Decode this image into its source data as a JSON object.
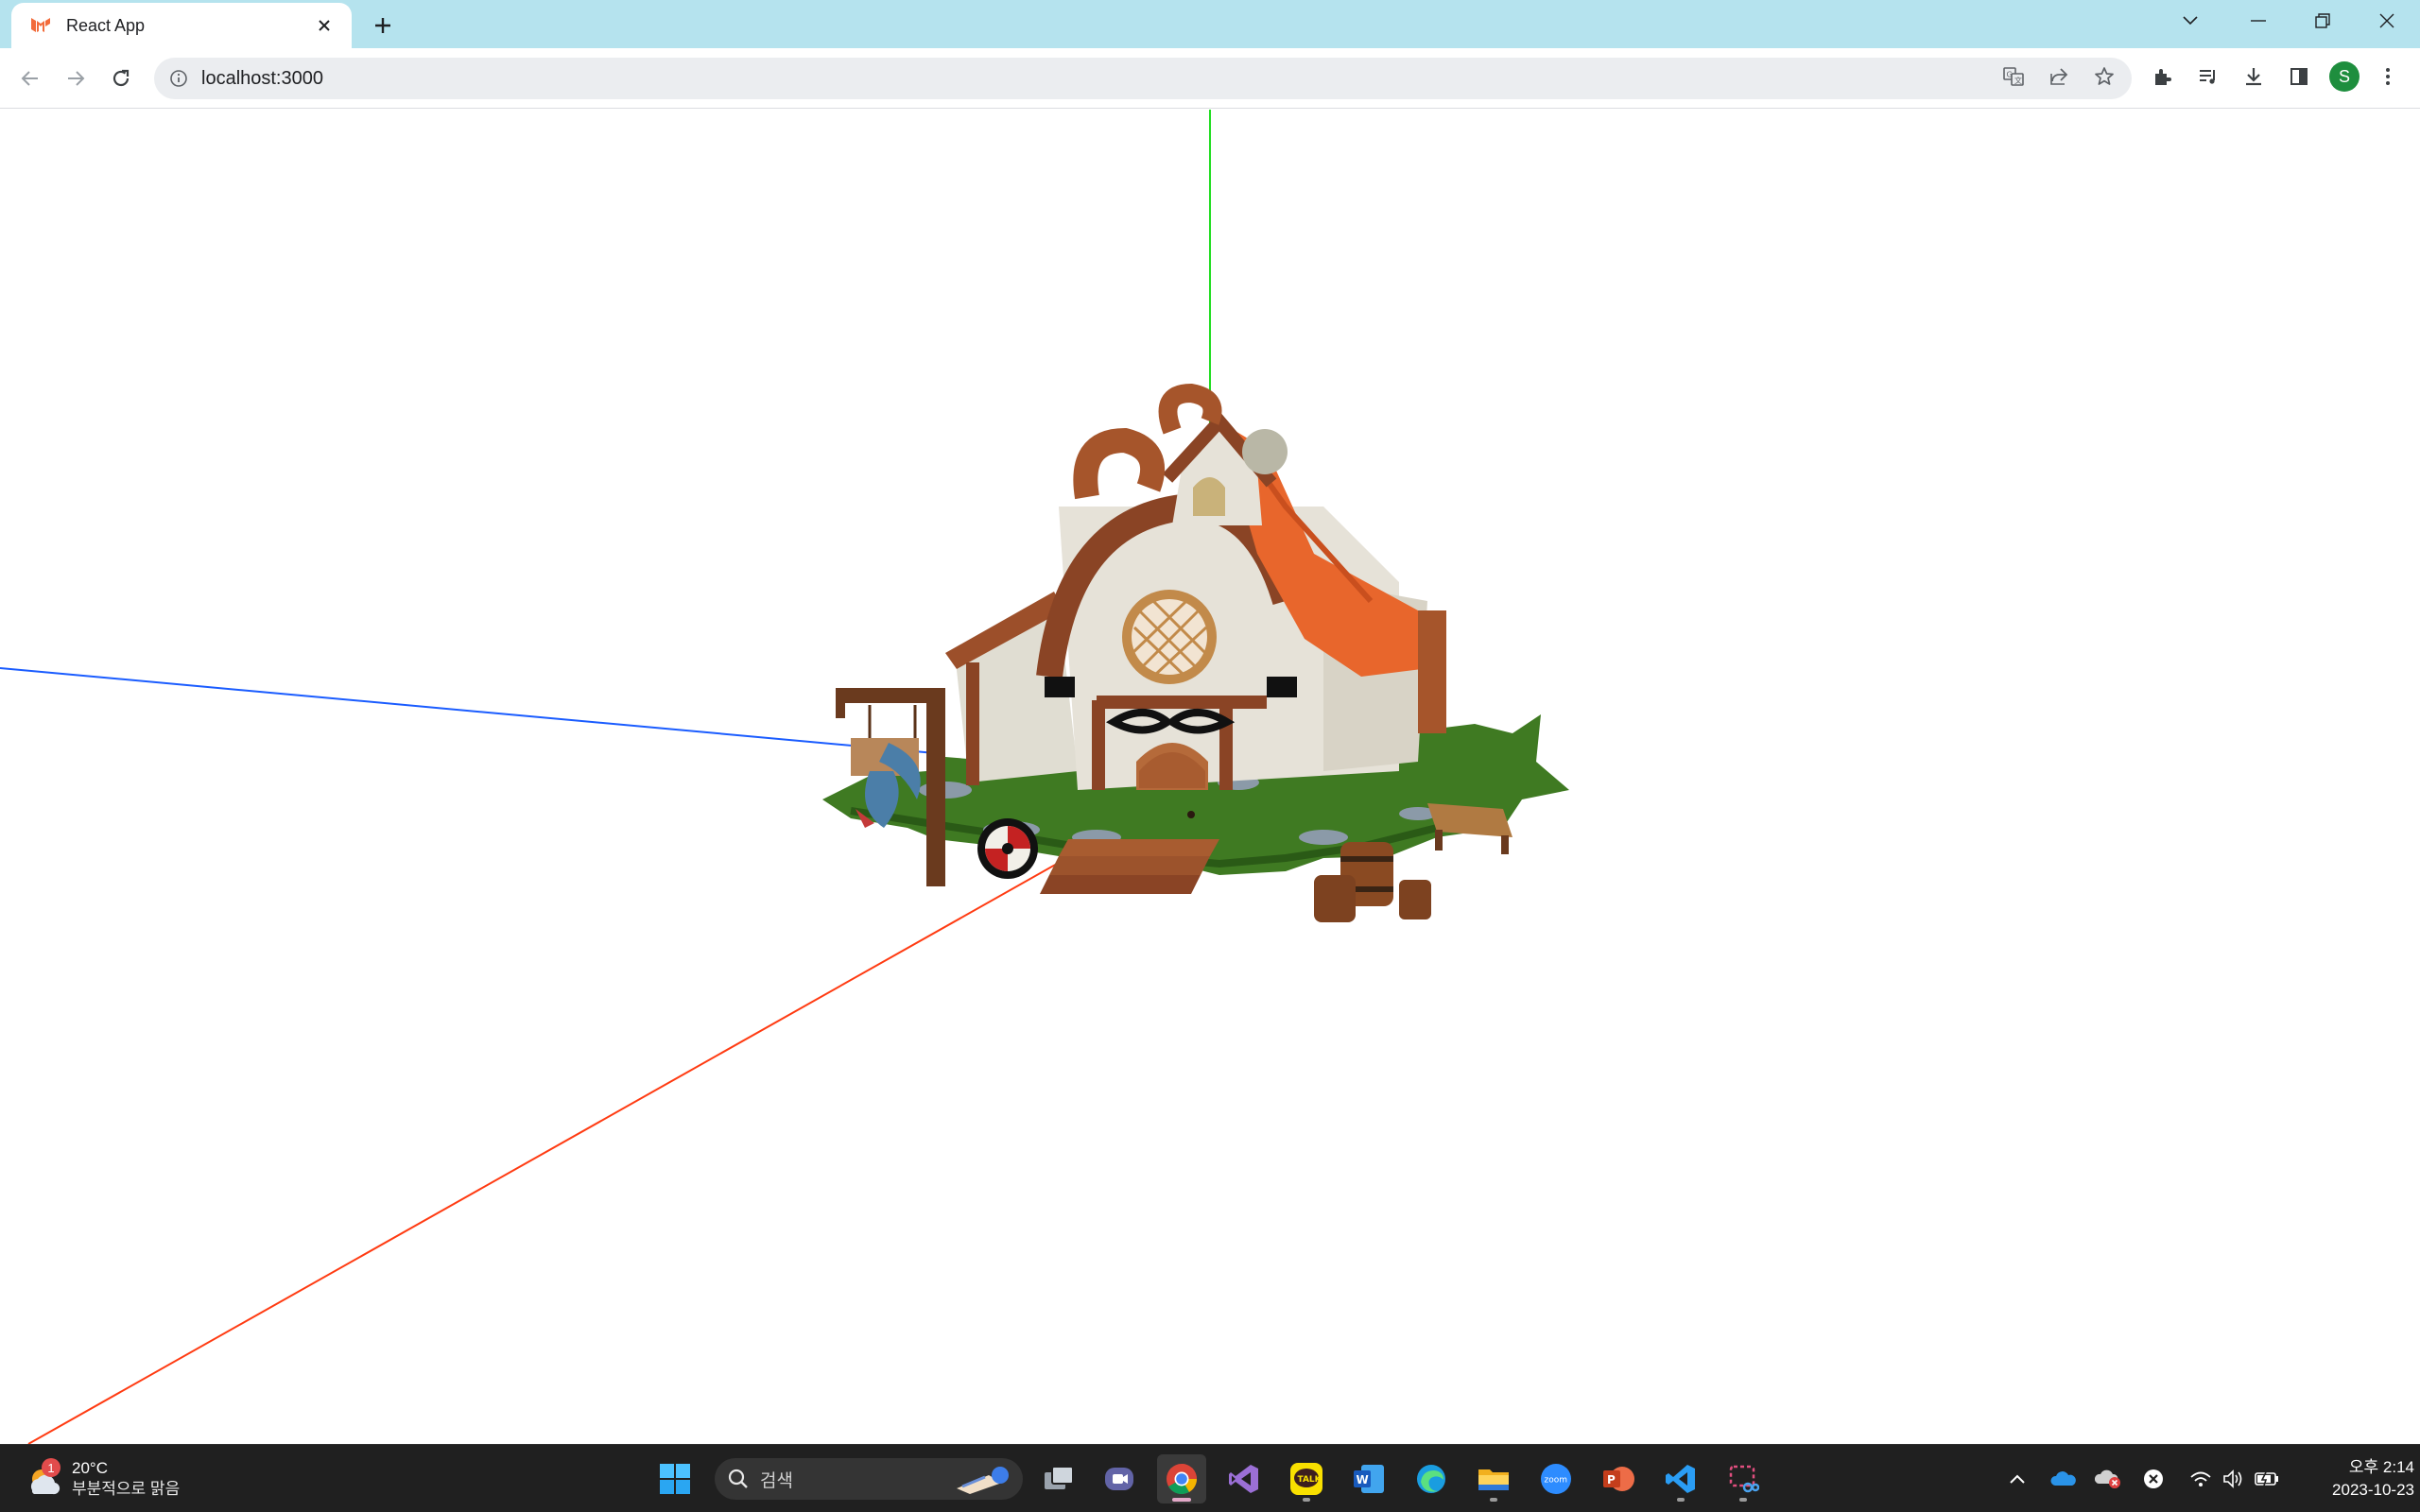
{
  "browser": {
    "tab": {
      "title": "React App",
      "favicon": "mui-logo-icon"
    },
    "new_tab_label": "+",
    "address": {
      "url": "localhost:3000"
    },
    "profile_initial": "S",
    "colors": {
      "tabstrip": "#b5e3ee",
      "omnibox": "#ebedf0",
      "profile": "#1e8e3e"
    }
  },
  "scene": {
    "description_icons": [
      "house-model",
      "axis-x-line",
      "axis-y-line",
      "axis-z-line"
    ],
    "axis_colors": {
      "x": "#ff3b12",
      "y": "#22dd22",
      "z": "#1a5cff"
    }
  },
  "taskbar": {
    "weather": {
      "badge": "1",
      "temperature": "20°C",
      "condition": "부분적으로 맑음"
    },
    "search": {
      "placeholder": "검색"
    },
    "clock": {
      "time": "오후 2:14",
      "date": "2023-10-23"
    }
  }
}
